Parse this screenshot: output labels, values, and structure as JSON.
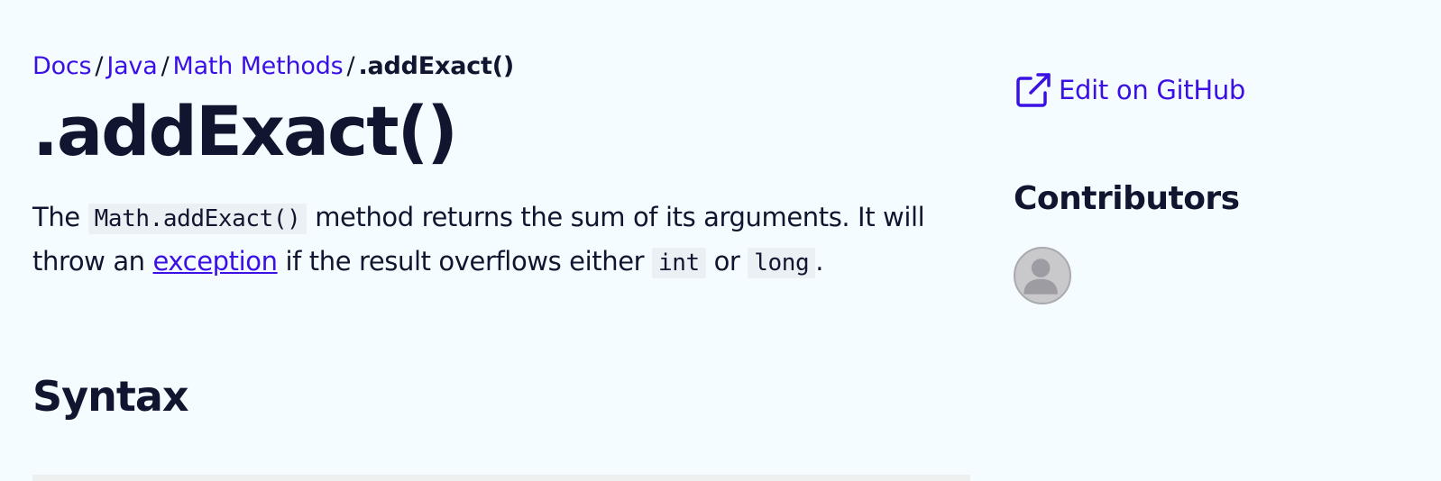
{
  "breadcrumb": {
    "items": [
      {
        "label": "Docs"
      },
      {
        "label": "Java"
      },
      {
        "label": "Math Methods"
      }
    ],
    "separator": "/",
    "current": ".addExact()"
  },
  "page": {
    "title": ".addExact()"
  },
  "intro": {
    "part1": "The ",
    "code1": "Math.addExact()",
    "part2": " method returns the sum of its arguments. It will throw an ",
    "link_label": "exception",
    "part3": " if the result overflows either ",
    "code2": "int",
    "part4": " or ",
    "code3": "long",
    "part5": "."
  },
  "syntax": {
    "heading": "Syntax"
  },
  "sidebar": {
    "edit_label": "Edit on GitHub",
    "edit_icon": "external-link-icon",
    "contributors_heading": "Contributors",
    "avatar_icon": "default-avatar-icon"
  },
  "colors": {
    "background": "#f5fcff",
    "link": "#3a10e5",
    "text": "#10162f",
    "code_bg": "#eaf0f3"
  }
}
